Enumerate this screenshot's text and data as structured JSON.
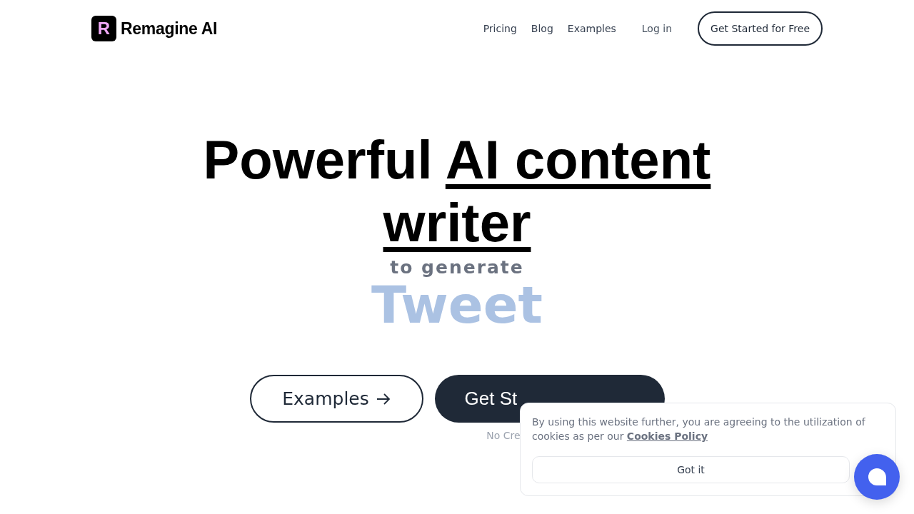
{
  "brand": {
    "name": "Remagine AI",
    "logo_letter": "R"
  },
  "nav": {
    "links": [
      "Pricing",
      "Blog",
      "Examples"
    ],
    "login": "Log in",
    "cta": "Get Started for Free"
  },
  "hero": {
    "heading_lead": "Powerful",
    "heading_highlight": "AI content writer",
    "subheading": "to generate",
    "rotating_word": "Tweet",
    "buttons": [
      {
        "kind": "outline",
        "label": "Examples"
      },
      {
        "kind": "solid",
        "label": "Get St"
      }
    ],
    "note": "No Cre"
  },
  "cookie_banner": {
    "text": "By using this website further, you are agreeing to the utilization of cookies as per our",
    "link": "Cookies Policy",
    "button": "Got it"
  }
}
